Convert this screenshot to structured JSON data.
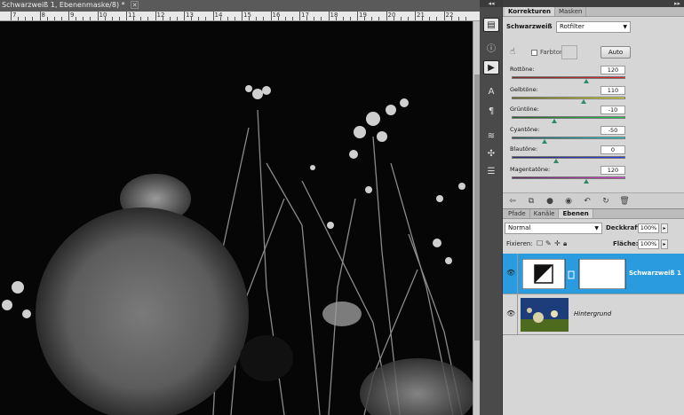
{
  "document": {
    "tab_title": "Schwarzweiß 1, Ebenenmaske/8) *",
    "close_glyph": "✕"
  },
  "ruler": {
    "labels": [
      "7",
      "8",
      "9",
      "10",
      "11",
      "12",
      "13",
      "14",
      "15",
      "16",
      "17",
      "18",
      "19",
      "20",
      "21",
      "22"
    ]
  },
  "toolstrip": {
    "collapse_glyph": "◂◂",
    "tools": [
      "histogram-icon",
      "info-icon",
      "actions-icon",
      "character-icon",
      "paragraph-icon",
      "brushes-icon",
      "clone-source-icon",
      "tool-presets-icon"
    ]
  },
  "panels": {
    "collapse_glyph": "▸▸",
    "adjustments": {
      "tabs": [
        "Korrekturen",
        "Masken"
      ],
      "title": "Schwarzweiß",
      "preset": "Rotfilter",
      "tint_label": "Farbton",
      "auto_label": "Auto",
      "sliders": [
        {
          "label": "Rottöne:",
          "value": "120",
          "pos": 0.67,
          "gradient": [
            "#7a2a2a",
            "#e8262b"
          ]
        },
        {
          "label": "Gelbtöne:",
          "value": "110",
          "pos": 0.64,
          "gradient": [
            "#6a6a1a",
            "#f2ef2a"
          ]
        },
        {
          "label": "Grüntöne:",
          "value": "-10",
          "pos": 0.38,
          "gradient": [
            "#2a5a2a",
            "#22d04a"
          ]
        },
        {
          "label": "Cyantöne:",
          "value": "-50",
          "pos": 0.29,
          "gradient": [
            "#2a5a5a",
            "#21d5d8"
          ]
        },
        {
          "label": "Blautöne:",
          "value": "0",
          "pos": 0.4,
          "gradient": [
            "#2a2a6a",
            "#2b3fe6"
          ]
        },
        {
          "label": "Magentatöne:",
          "value": "120",
          "pos": 0.67,
          "gradient": [
            "#5a2a5a",
            "#e23cd8"
          ]
        }
      ],
      "footer_icons": [
        "back-icon",
        "view-icon",
        "mask-icon",
        "visibility-icon",
        "previous-state-icon",
        "reset-icon",
        "delete-icon"
      ]
    },
    "layers": {
      "tabs": [
        "Pfade",
        "Kanäle",
        "Ebenen"
      ],
      "blend_mode": "Normal",
      "opacity_label": "Deckkraft:",
      "opacity_value": "100%",
      "lock_label": "Fixieren:",
      "fill_label": "Fläche:",
      "fill_value": "100%",
      "items": [
        {
          "name": "Schwarzweiß 1",
          "selected": true
        },
        {
          "name": "Hintergrund",
          "selected": false
        }
      ]
    }
  },
  "colors": {
    "selection": "#2b9be0",
    "panel_bg": "#d6d6d6"
  }
}
